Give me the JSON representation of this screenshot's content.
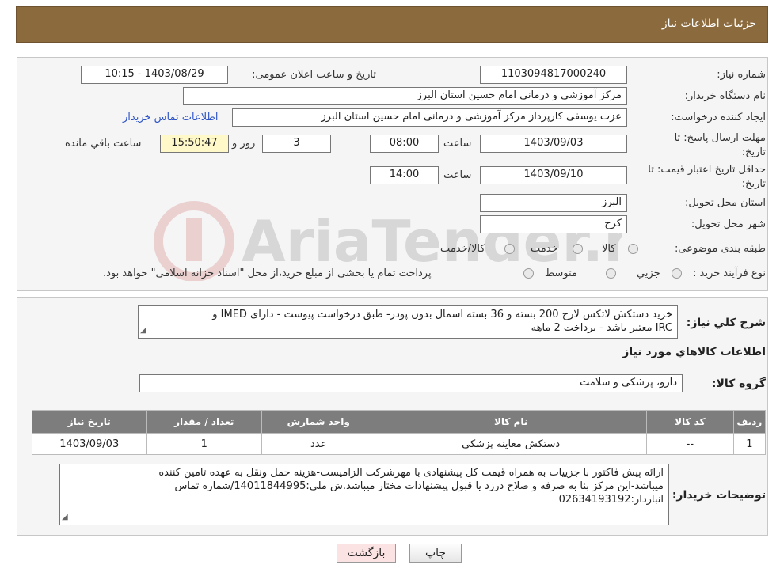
{
  "header": {
    "title": "جزئیات اطلاعات نیاز"
  },
  "form": {
    "need_number": {
      "label": "شماره نیاز:",
      "value": "1103094817000240"
    },
    "announce": {
      "label": "تاریخ و ساعت اعلان عمومی:",
      "value": "1403/08/29 - 10:15"
    },
    "buyer_org": {
      "label": "نام دستگاه خریدار:",
      "value": "مرکز آموزشی و درمانی امام حسین استان البرز"
    },
    "creator": {
      "label": "ایجاد کننده درخواست:",
      "value": "عزت یوسفی کارپرداز مرکز آموزشی و درمانی امام حسین استان البرز",
      "contact_link": "اطلاعات تماس خریدار"
    },
    "deadline": {
      "label": "مهلت ارسال پاسخ: تا تاریخ:",
      "date": "1403/09/03",
      "time_label": "ساعت",
      "time": "08:00",
      "days": "3",
      "days_label": "روز و",
      "remaining": "15:50:47",
      "remaining_label": "ساعت باقي مانده"
    },
    "validity": {
      "label": "حداقل تاریخ اعتبار قیمت: تا تاریخ:",
      "date": "1403/09/10",
      "time_label": "ساعت",
      "time": "14:00"
    },
    "province": {
      "label": "استان محل تحویل:",
      "value": "البرز"
    },
    "city": {
      "label": "شهر محل تحویل:",
      "value": "کرج"
    },
    "category": {
      "label": "طبقه بندی موضوعی:",
      "options": [
        "کالا",
        "خدمت",
        "کالا/خدمت"
      ]
    },
    "process": {
      "label": "نوع فرآیند خرید :",
      "options": [
        "جزيي",
        "متوسط"
      ],
      "note": "پرداخت تمام یا بخشی از مبلغ خرید،از محل \"اسناد خزانه اسلامی\" خواهد بود."
    }
  },
  "details": {
    "summary_label": "شرح کلي نياز:",
    "summary_line1": "خرید دستکش لاتکس لارج 200 بسته و 36 بسته اسمال بدون پودر- طبق درخواست پیوست - دارای IMED  و",
    "summary_line2": "IRC  معتبر باشد - برداخت 2 ماهه",
    "items_title": "اطلاعات کالاهاي مورد نياز",
    "group_label": "گروه کالا:",
    "group_value": "دارو، پزشکی و سلامت"
  },
  "table": {
    "headers": [
      "رديف",
      "کد کالا",
      "نام کالا",
      "واحد شمارش",
      "تعداد / مقدار",
      "تاریخ نیاز"
    ],
    "rows": [
      [
        "1",
        "--",
        "دستکش معاینه پزشکی",
        "عدد",
        "1",
        "1403/09/03"
      ]
    ]
  },
  "buyer_notes": {
    "label": "توضیحات خریدار:",
    "line1": "ارائه پیش فاکتور با جزییات به همراه قیمت کل پیشنهادی با مهرشرکت الزامیست-هزینه حمل ونقل به عهده تامین کننده",
    "line2": "میباشد-این مرکز بنا به صرفه و صلاح درزد یا قبول پیشنهادات مختار میباشد.ش ملی:14011844995/شماره تماس",
    "line3": "انباردار:02634193192"
  },
  "buttons": {
    "print": "چاپ",
    "back": "بازگشت"
  },
  "colors": {
    "header_bg": "#8b6a3e",
    "table_header_bg": "#7d7d7d",
    "back_button_bg": "#fbe3e3"
  }
}
